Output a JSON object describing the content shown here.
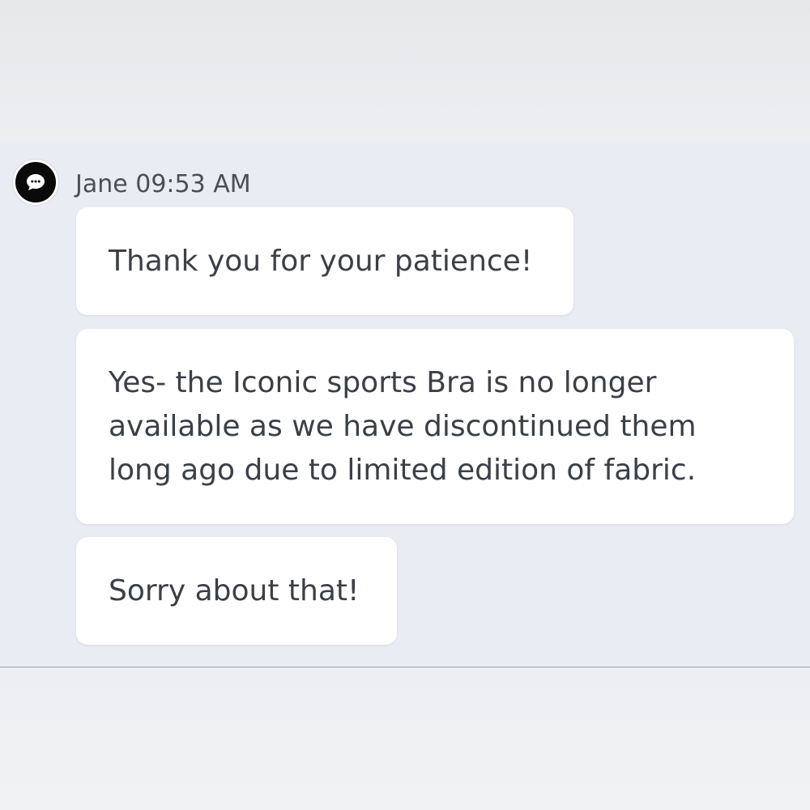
{
  "chat": {
    "sender": "Jane",
    "time": "09:53 AM",
    "meta_text": "Jane 09:53 AM",
    "avatar_icon": "chat-bubble-icon",
    "messages": [
      {
        "text": "Thank you for your patience!"
      },
      {
        "text": "Yes- the Iconic sports Bra is no longer\navailable as we have discontinued them\nlong ago due to limited edition of fabric."
      },
      {
        "text": "Sorry about that!"
      }
    ]
  },
  "colors": {
    "chat_background": "#e9edf3",
    "bubble_background": "#ffffff",
    "avatar_background": "#0a0a0a",
    "text": "#3b4047"
  }
}
